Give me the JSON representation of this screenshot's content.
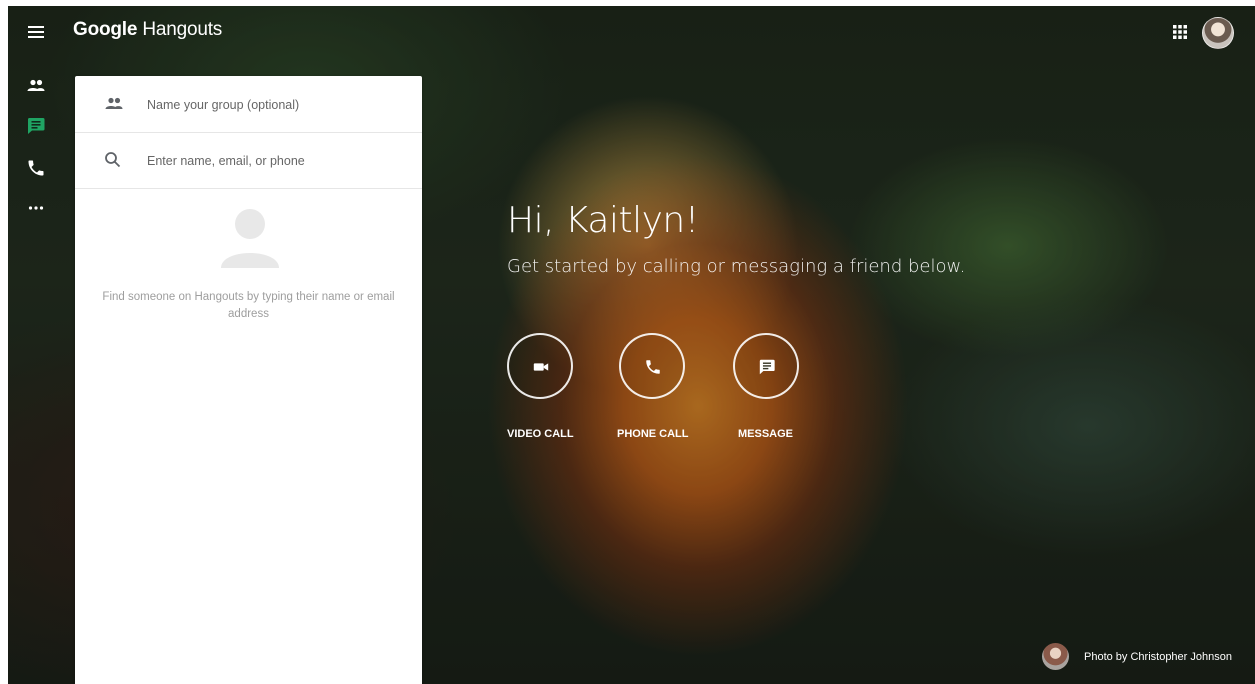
{
  "app": {
    "brand": "Google",
    "product": "Hangouts"
  },
  "panel": {
    "group_placeholder": "Name your group (optional)",
    "search_placeholder": "Enter name, email, or phone",
    "empty_text": "Find someone on Hangouts by typing their name or email address"
  },
  "greeting": {
    "title": "Hi, Kaitlyn!",
    "subtitle": "Get started by calling or messaging a friend below."
  },
  "actions": [
    {
      "label": "VIDEO CALL",
      "icon": "videocam-icon"
    },
    {
      "label": "PHONE CALL",
      "icon": "phone-icon"
    },
    {
      "label": "MESSAGE",
      "icon": "message-icon"
    }
  ],
  "rail": [
    {
      "icon": "people-icon",
      "active": false
    },
    {
      "icon": "chat-icon",
      "active": true
    },
    {
      "icon": "phone-icon",
      "active": false
    },
    {
      "icon": "more-icon",
      "active": false
    }
  ],
  "credit": {
    "text": "Photo by Christopher Johnson"
  },
  "colors": {
    "accent_green": "#1fa463",
    "rail_icon": "#ffffff",
    "panel_icon": "#757575"
  }
}
